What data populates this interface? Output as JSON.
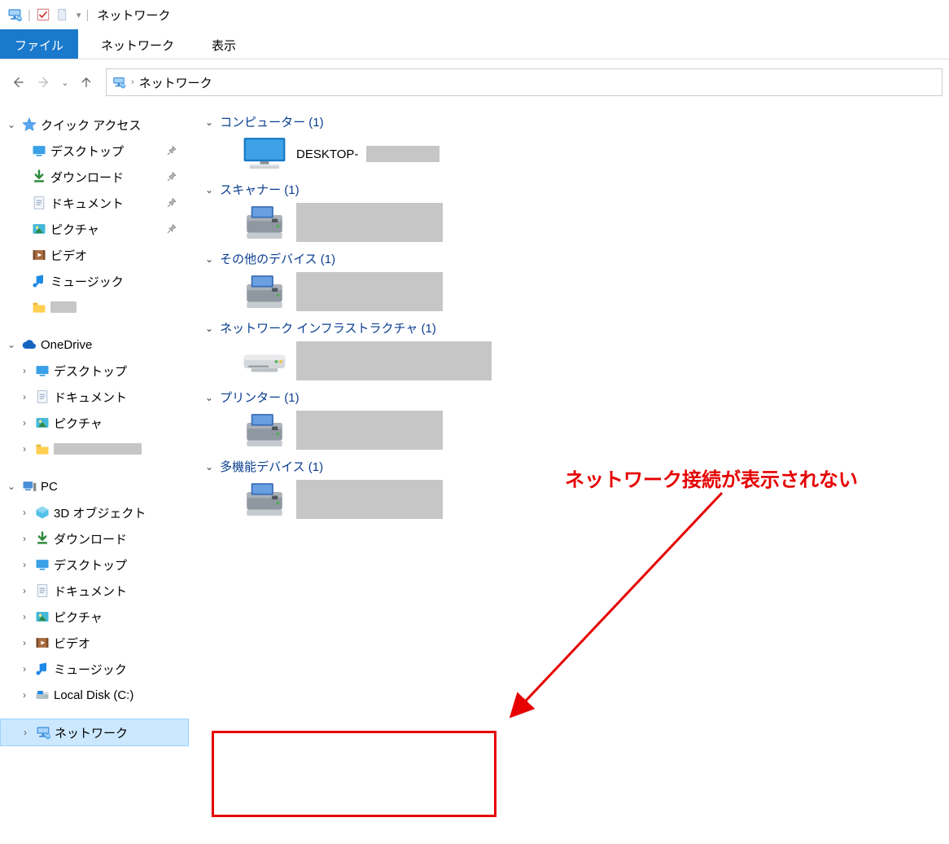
{
  "title": "ネットワーク",
  "ribbons": {
    "file": "ファイル",
    "network": "ネットワーク",
    "view": "表示"
  },
  "address": {
    "location": "ネットワーク",
    "sep": "›"
  },
  "sidebar": {
    "quick_access": "クイック アクセス",
    "desktop": "デスクトップ",
    "downloads": "ダウンロード",
    "documents": "ドキュメント",
    "pictures": "ピクチャ",
    "videos": "ビデオ",
    "music": "ミュージック",
    "onedrive": "OneDrive",
    "od_desktop": "デスクトップ",
    "od_documents": "ドキュメント",
    "od_pictures": "ピクチャ",
    "pc": "PC",
    "pc_3d": "3D オブジェクト",
    "pc_downloads": "ダウンロード",
    "pc_desktop": "デスクトップ",
    "pc_documents": "ドキュメント",
    "pc_pictures": "ピクチャ",
    "pc_videos": "ビデオ",
    "pc_music": "ミュージック",
    "pc_disk": "Local Disk (C:)",
    "network": "ネットワーク"
  },
  "sections": {
    "computer": "コンピューター  (1)",
    "computer_item": "DESKTOP-",
    "scanner": "スキャナー  (1)",
    "otherdev": "その他のデバイス  (1)",
    "netinfra": "ネットワーク インフラストラクチャ  (1)",
    "printer": "プリンター  (1)",
    "multidev": "多機能デバイス  (1)"
  },
  "annotation": "ネットワーク接続が表示されない"
}
